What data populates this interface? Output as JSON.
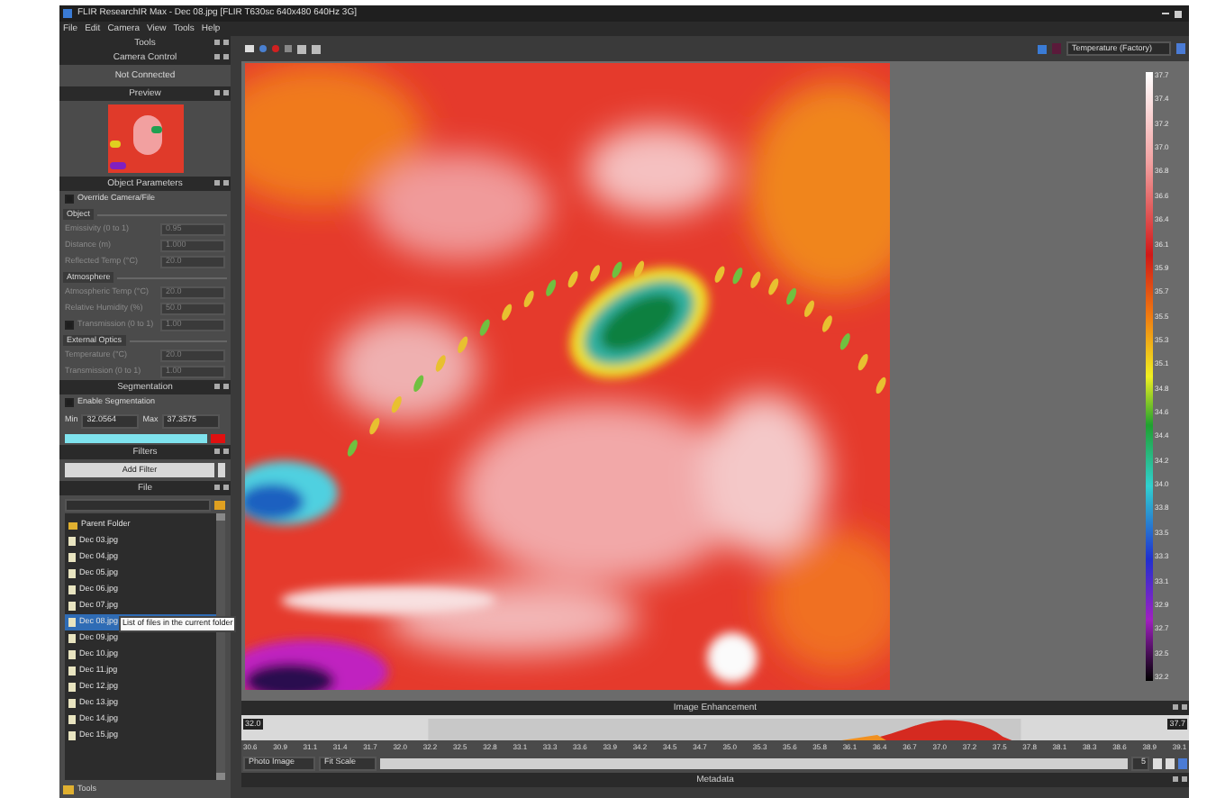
{
  "window": {
    "title": "FLIR ResearchIR Max - Dec 08.jpg [FLIR T630sc 640x480 640Hz 3G]"
  },
  "menu": [
    "File",
    "Edit",
    "Camera",
    "View",
    "Tools",
    "Help"
  ],
  "tools_panel": {
    "title": "Tools"
  },
  "camera_control": {
    "title": "Camera Control",
    "status": "Not Connected"
  },
  "preview": {
    "title": "Preview"
  },
  "object_parameters": {
    "title": "Object Parameters",
    "override": {
      "label": "Override Camera/File",
      "checked": false
    },
    "groups": [
      {
        "title": "Object",
        "fields": [
          {
            "kind": "plain",
            "label": "Emissivity (0 to 1)",
            "value": "0.95",
            "disabled": true
          },
          {
            "kind": "plain",
            "label": "Distance (m)",
            "value": "1.000",
            "disabled": true
          },
          {
            "kind": "plain",
            "label": "Reflected Temp (°C)",
            "value": "20.0",
            "disabled": true
          }
        ]
      },
      {
        "title": "Atmosphere",
        "fields": [
          {
            "kind": "plain",
            "label": "Atmospheric Temp (°C)",
            "value": "20.0",
            "disabled": true
          },
          {
            "kind": "plain",
            "label": "Relative Humidity (%)",
            "value": "50.0",
            "disabled": true
          },
          {
            "kind": "check",
            "label": "Transmission (0 to 1)",
            "value": "1.00",
            "disabled": true,
            "checked": false
          }
        ]
      },
      {
        "title": "External Optics",
        "fields": [
          {
            "kind": "plain",
            "label": "Temperature (°C)",
            "value": "20.0",
            "disabled": true
          },
          {
            "kind": "plain",
            "label": "Transmission (0 to 1)",
            "value": "1.00",
            "disabled": true
          }
        ]
      }
    ]
  },
  "segmentation": {
    "title": "Segmentation",
    "enable": {
      "label": "Enable Segmentation",
      "checked": false
    },
    "min_label": "Min",
    "min": "32.0564",
    "max_label": "Max",
    "max": "37.3575"
  },
  "filters": {
    "title": "Filters",
    "button": "Add Filter"
  },
  "file": {
    "title": "File",
    "tooltip": "List of files in the current folder",
    "footer": "Tools",
    "items": [
      {
        "name": "Parent Folder",
        "kind": "folder",
        "selected": false
      },
      {
        "name": "Dec 03.jpg",
        "kind": "file",
        "selected": false
      },
      {
        "name": "Dec 04.jpg",
        "kind": "file",
        "selected": false
      },
      {
        "name": "Dec 05.jpg",
        "kind": "file",
        "selected": false
      },
      {
        "name": "Dec 06.jpg",
        "kind": "file",
        "selected": false
      },
      {
        "name": "Dec 07.jpg",
        "kind": "file",
        "selected": false
      },
      {
        "name": "Dec 08.jpg",
        "kind": "file",
        "selected": true
      },
      {
        "name": "Dec 09.jpg",
        "kind": "file",
        "selected": false
      },
      {
        "name": "Dec 10.jpg",
        "kind": "file",
        "selected": false
      },
      {
        "name": "Dec 11.jpg",
        "kind": "file",
        "selected": false
      },
      {
        "name": "Dec 12.jpg",
        "kind": "file",
        "selected": false
      },
      {
        "name": "Dec 13.jpg",
        "kind": "file",
        "selected": false
      },
      {
        "name": "Dec 14.jpg",
        "kind": "file",
        "selected": false
      },
      {
        "name": "Dec 15.jpg",
        "kind": "file",
        "selected": false
      }
    ]
  },
  "view_toolbar": {
    "palette": "Temperature (Factory)"
  },
  "color_scale": {
    "ticks": [
      "37.7",
      "37.4",
      "37.2",
      "37.0",
      "36.8",
      "36.6",
      "36.4",
      "36.1",
      "35.9",
      "35.7",
      "35.5",
      "35.3",
      "35.1",
      "34.8",
      "34.6",
      "34.4",
      "34.2",
      "34.0",
      "33.8",
      "33.5",
      "33.3",
      "33.1",
      "32.9",
      "32.7",
      "32.5",
      "32.2"
    ]
  },
  "image_enhancement": {
    "title": "Image Enhancement",
    "min": "32.0",
    "max": "37.7",
    "axis": [
      "30.6",
      "30.9",
      "31.1",
      "31.4",
      "31.7",
      "32.0",
      "32.2",
      "32.5",
      "32.8",
      "33.1",
      "33.3",
      "33.6",
      "33.9",
      "34.2",
      "34.5",
      "34.7",
      "35.0",
      "35.3",
      "35.6",
      "35.8",
      "36.1",
      "36.4",
      "36.7",
      "37.0",
      "37.2",
      "37.5",
      "37.8",
      "38.1",
      "38.3",
      "38.6",
      "38.9",
      "39.1"
    ]
  },
  "controls": {
    "mode": "Photo Image",
    "scale": "Fit Scale",
    "step": "5"
  },
  "metadata": {
    "title": "Metadata"
  }
}
